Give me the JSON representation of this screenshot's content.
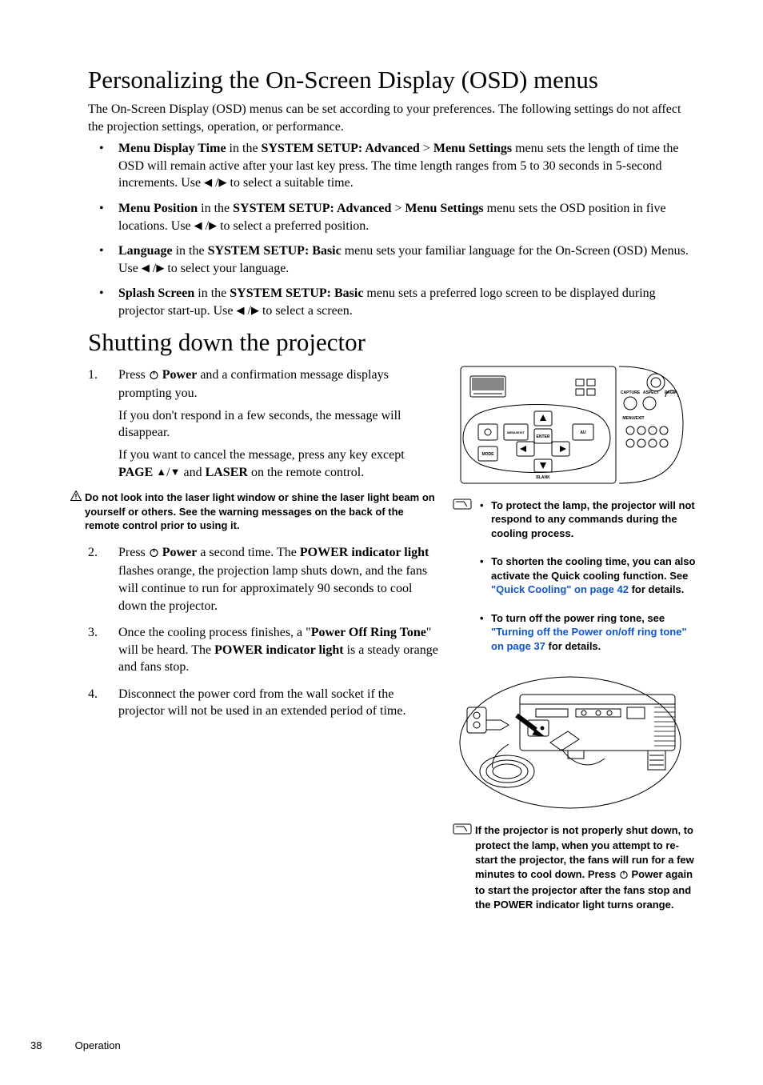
{
  "s1": {
    "title": "Personalizing the On-Screen Display (OSD) menus",
    "intro": "The On-Screen Display (OSD) menus can be set according to your preferences. The following settings do not affect the projection settings, operation, or performance.",
    "b1a": "Menu Display Time",
    "b1b": " in the ",
    "b1c": "SYSTEM SETUP: Advanced",
    "b1d": " > ",
    "b1e": "Menu Settings",
    "b1f": " menu sets the length of time the OSD will remain active after your last key press. The time length ranges from 5 to 30 seconds in 5-second increments. Use ",
    "b1g": " to select a suitable time.",
    "b2a": "Menu Position",
    "b2b": " in the ",
    "b2c": "SYSTEM SETUP: Advanced",
    "b2d": " > ",
    "b2e": "Menu Settings",
    "b2f": " menu sets the OSD position in five locations. Use ",
    "b2g": " to select a preferred position.",
    "b3a": "Language",
    "b3b": " in the ",
    "b3c": "SYSTEM SETUP: Basic",
    "b3d": " menu sets your familiar language for the On-Screen (OSD) Menus. Use ",
    "b3e": " to select your language.",
    "b4a": "Splash Screen",
    "b4b": " in the ",
    "b4c": "SYSTEM SETUP: Basic",
    "b4d": " menu sets a preferred logo screen to be displayed during projector start-up. Use ",
    "b4e": " to select a screen."
  },
  "s2": {
    "title": "Shutting down the projector",
    "n1": "1.",
    "n2": "2.",
    "n3": "3.",
    "n4": "4.",
    "st1a": "Press ",
    "st1b": "Power",
    "st1c": " and a confirmation message displays prompting you.",
    "st1d": "If you don't respond in a few seconds, the message will disappear.",
    "st1e": "If you want to cancel the message, press any key except ",
    "st1f": "PAGE",
    "st1g": " and ",
    "st1h": "LASER",
    "st1i": " on the remote control.",
    "warn": "Do not look into the laser light window or shine the laser light beam on yourself or others. See the warning messages on the back of the remote control prior to using it.",
    "st2a": "Press ",
    "st2b": "Power",
    "st2c": " a second time. The ",
    "st2d": "POWER indicator light",
    "st2e": " flashes orange, the projection lamp shuts down, and the fans will continue to run for approximately 90 seconds to cool down the projector.",
    "st3a": "Once the cooling process finishes, a \"",
    "st3b": "Power Off Ring Tone",
    "st3c": "\" will be heard. The ",
    "st3d": "POWER indicator light",
    "st3e": " is a steady orange and fans stop.",
    "st4": "Disconnect the power cord from the wall socket if the projector will not be used in an extended period of time."
  },
  "right": {
    "n1": "To protect the lamp, the projector will not respond to any commands during the cooling process.",
    "n2a": "To shorten the cooling time, you can also activate the Quick cooling function. See ",
    "n2b": "\"Quick Cooling\" on page 42",
    "n2c": " for details.",
    "n3a": "To turn off the power ring tone, see ",
    "n3b": "\"Turning off the Power on/off ring tone\" on page 37",
    "n3c": " for details.",
    "imp_a": "If the projector is not properly shut down, to protect the lamp, when you attempt to re-start the projector, the fans will run for a few minutes to cool down. Press ",
    "imp_b": "Power again to start the projector after the fans stop and the POWER indicator light turns orange."
  },
  "footer": {
    "page": "38",
    "section": "Operation"
  }
}
